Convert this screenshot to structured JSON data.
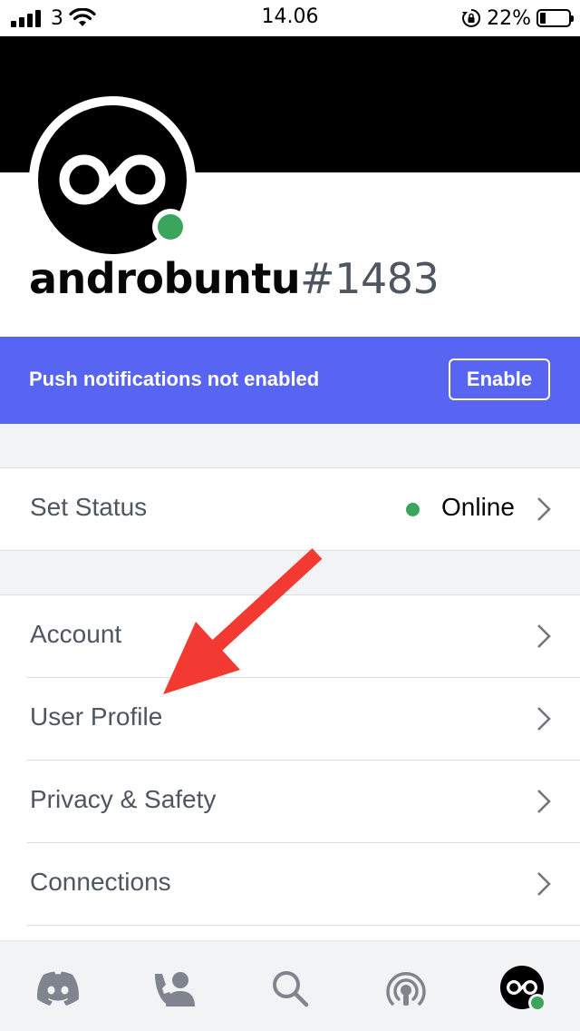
{
  "status_bar": {
    "carrier": "3",
    "time": "14.06",
    "battery_percent": "22%",
    "battery_level": 0.22,
    "icons": [
      "signal-icon",
      "wifi-icon",
      "orientation-lock-icon",
      "battery-icon"
    ]
  },
  "profile": {
    "username": "androbuntu",
    "discriminator": "#1483",
    "presence": "online",
    "avatar_icon": "ab-logo-icon"
  },
  "push_banner": {
    "message": "Push notifications not enabled",
    "button_label": "Enable"
  },
  "status_row": {
    "label": "Set Status",
    "value": "Online"
  },
  "settings": {
    "items": [
      {
        "label": "Account"
      },
      {
        "label": "User Profile"
      },
      {
        "label": "Privacy & Safety"
      },
      {
        "label": "Connections"
      }
    ]
  },
  "tabbar": {
    "items": [
      "discord-home-icon",
      "friends-icon",
      "search-icon",
      "mentions-icon",
      "profile-avatar"
    ]
  },
  "colors": {
    "blurple": "#5865f2",
    "online_green": "#3ba55d",
    "annotation_arrow": "#f23a32",
    "banner": "#000000"
  }
}
